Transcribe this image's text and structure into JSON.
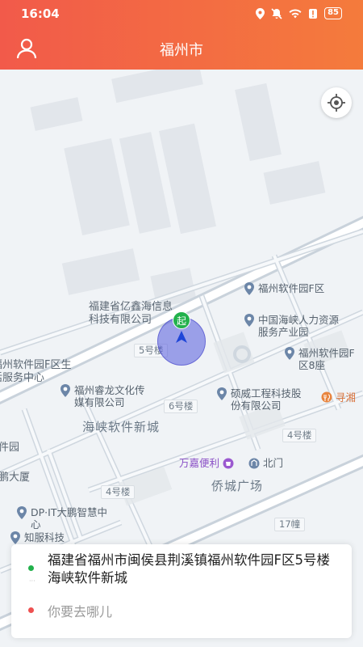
{
  "status": {
    "time": "16:04",
    "battery": "85"
  },
  "header": {
    "title": "福州市",
    "user_icon": "user-icon"
  },
  "map": {
    "area_labels": [
      {
        "text": "海峡软件新城",
        "size": "big"
      },
      {
        "text": "侨城广场",
        "size": "big"
      }
    ],
    "pois": [
      "福州软件园F区",
      "中国海峡人力资源服务产业园",
      "福州软件园F区8座",
      "福州睿龙文化传媒有限公司",
      "硕威工程科技股份有限公司",
      "寻湘",
      "万嘉便利",
      "北门",
      "DP·IT大鹏智慧中心",
      "知服科技"
    ],
    "labels": [
      "福建省亿鑫海信息科技有限公司",
      "福州软件园F区生活服务中心",
      "件园",
      "鹏大厦"
    ],
    "road_tags": [
      "5号楼",
      "6号楼",
      "4号楼",
      "4号楼",
      "17幢"
    ],
    "start_marker": "起"
  },
  "panel": {
    "origin": "福建省福州市闽侯县荆溪镇福州软件园F区5号楼海峡软件新城",
    "destination_placeholder": "你要去哪儿",
    "dots": "···"
  },
  "colors": {
    "header_start": "#f25a4a",
    "header_end": "#f47b3c",
    "origin_dot": "#22b14c",
    "dest_dot": "#ee5050"
  }
}
